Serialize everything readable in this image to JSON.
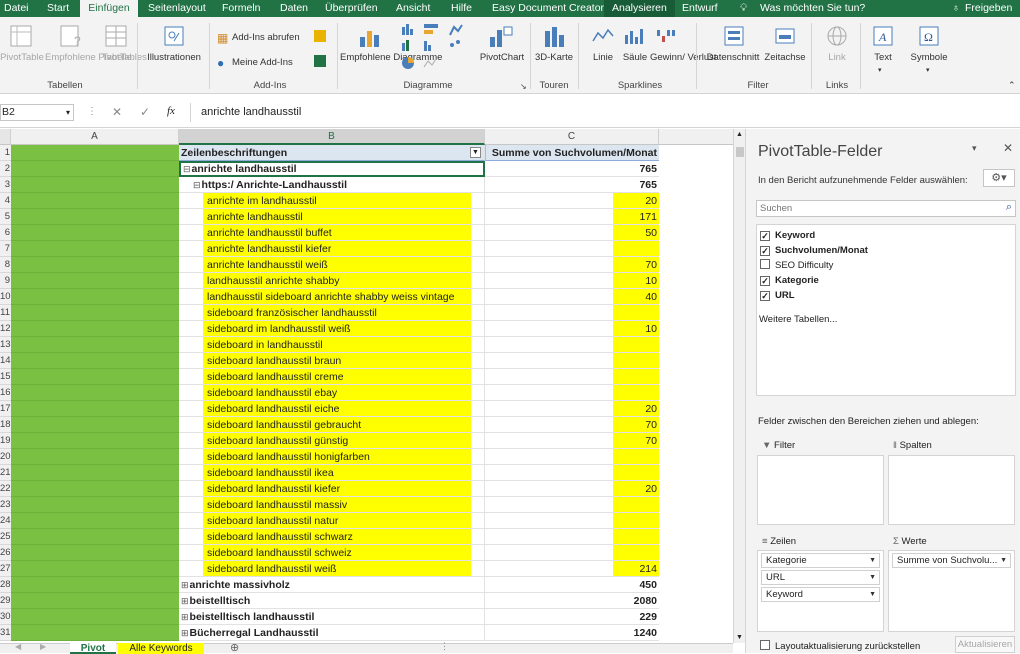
{
  "menubar": {
    "tabs": [
      "Datei",
      "Start",
      "Einfügen",
      "Seitenlayout",
      "Formeln",
      "Daten",
      "Überprüfen",
      "Ansicht",
      "Hilfe",
      "Easy Document Creator",
      "Analysieren",
      "Entwurf"
    ],
    "tell_me": "Was möchten Sie tun?",
    "share": "Freigeben"
  },
  "ribbon": {
    "pivottable": "PivotTable",
    "rec_pivot": "Empfohlene PivotTables",
    "table": "Tabelle",
    "grp_tables": "Tabellen",
    "illustrations": "Illustrationen",
    "addins_get": "Add-Ins abrufen",
    "my_addins": "Meine Add-Ins",
    "grp_addins": "Add-Ins",
    "rec_charts": "Empfohlene Diagramme",
    "grp_charts": "Diagramme",
    "pivotchart": "PivotChart",
    "map3d": "3D-Karte",
    "grp_tours": "Touren",
    "line": "Linie",
    "column": "Säule",
    "winloss": "Gewinn/ Verlust",
    "grp_sparklines": "Sparklines",
    "slicer": "Datenschnitt",
    "timeline": "Zeitachse",
    "grp_filter": "Filter",
    "link": "Link",
    "grp_links": "Links",
    "text": "Text",
    "symbols": "Symbole"
  },
  "formula": {
    "namebox": "B2",
    "fx": "fx",
    "value": "anrichte landhausstil"
  },
  "grid": {
    "col_a": "A",
    "col_b": "B",
    "col_c": "C",
    "header_b": "Zeilenbeschriftungen",
    "header_c": "Summe von Suchvolumen/Monat",
    "rows": [
      {
        "n": "2",
        "label": "anrichte landhausstil",
        "val": "765",
        "lvl": 0,
        "bold": true,
        "yellow": false
      },
      {
        "n": "3",
        "label": "https:/                  Anrichte-Landhausstil",
        "val": "765",
        "lvl": 1,
        "bold": true,
        "yellow": false
      },
      {
        "n": "4",
        "label": "anrichte im landhausstil",
        "val": "20",
        "lvl": 2,
        "yellow": true
      },
      {
        "n": "5",
        "label": "anrichte landhausstil",
        "val": "171",
        "lvl": 2,
        "yellow": true
      },
      {
        "n": "6",
        "label": "anrichte landhausstil buffet",
        "val": "50",
        "lvl": 2,
        "yellow": true
      },
      {
        "n": "7",
        "label": "anrichte landhausstil kiefer",
        "val": "",
        "lvl": 2,
        "yellow": true
      },
      {
        "n": "8",
        "label": "anrichte landhausstil weiß",
        "val": "70",
        "lvl": 2,
        "yellow": true
      },
      {
        "n": "9",
        "label": "landhausstil anrichte shabby",
        "val": "10",
        "lvl": 2,
        "yellow": true
      },
      {
        "n": "10",
        "label": "landhausstil sideboard anrichte shabby weiss vintage",
        "val": "40",
        "lvl": 2,
        "yellow": true
      },
      {
        "n": "11",
        "label": "sideboard französischer landhausstil",
        "val": "",
        "lvl": 2,
        "yellow": true
      },
      {
        "n": "12",
        "label": "sideboard im landhausstil weiß",
        "val": "10",
        "lvl": 2,
        "yellow": true
      },
      {
        "n": "13",
        "label": "sideboard in landhausstil",
        "val": "",
        "lvl": 2,
        "yellow": true
      },
      {
        "n": "14",
        "label": "sideboard landhausstil braun",
        "val": "",
        "lvl": 2,
        "yellow": true
      },
      {
        "n": "15",
        "label": "sideboard landhausstil creme",
        "val": "",
        "lvl": 2,
        "yellow": true
      },
      {
        "n": "16",
        "label": "sideboard landhausstil ebay",
        "val": "",
        "lvl": 2,
        "yellow": true
      },
      {
        "n": "17",
        "label": "sideboard landhausstil eiche",
        "val": "20",
        "lvl": 2,
        "yellow": true
      },
      {
        "n": "18",
        "label": "sideboard landhausstil gebraucht",
        "val": "70",
        "lvl": 2,
        "yellow": true
      },
      {
        "n": "19",
        "label": "sideboard landhausstil günstig",
        "val": "70",
        "lvl": 2,
        "yellow": true
      },
      {
        "n": "20",
        "label": "sideboard landhausstil honigfarben",
        "val": "",
        "lvl": 2,
        "yellow": true
      },
      {
        "n": "21",
        "label": "sideboard landhausstil ikea",
        "val": "",
        "lvl": 2,
        "yellow": true
      },
      {
        "n": "22",
        "label": "sideboard landhausstil kiefer",
        "val": "20",
        "lvl": 2,
        "yellow": true
      },
      {
        "n": "23",
        "label": "sideboard landhausstil massiv",
        "val": "",
        "lvl": 2,
        "yellow": true
      },
      {
        "n": "24",
        "label": "sideboard landhausstil natur",
        "val": "",
        "lvl": 2,
        "yellow": true
      },
      {
        "n": "25",
        "label": "sideboard landhausstil schwarz",
        "val": "",
        "lvl": 2,
        "yellow": true
      },
      {
        "n": "26",
        "label": "sideboard landhausstil schweiz",
        "val": "",
        "lvl": 2,
        "yellow": true
      },
      {
        "n": "27",
        "label": "sideboard landhausstil weiß",
        "val": "214",
        "lvl": 2,
        "yellow": true
      },
      {
        "n": "28",
        "label": "anrichte massivholz",
        "val": "450",
        "lvl": 0,
        "bold": true,
        "yellow": false,
        "collapsed": true
      },
      {
        "n": "29",
        "label": "beistelltisch",
        "val": "2080",
        "lvl": 0,
        "bold": true,
        "yellow": false,
        "collapsed": true
      },
      {
        "n": "30",
        "label": "beistelltisch landhausstil",
        "val": "229",
        "lvl": 0,
        "bold": true,
        "yellow": false,
        "collapsed": true
      },
      {
        "n": "31",
        "label": "Bücherregal Landhausstil",
        "val": "1240",
        "lvl": 0,
        "bold": true,
        "yellow": false,
        "collapsed": true
      }
    ]
  },
  "sheets": {
    "tab1": "Pivot",
    "tab2": "Alle Keywords"
  },
  "panel": {
    "title": "PivotTable-Felder",
    "subtitle": "In den Bericht aufzunehmende Felder auswählen:",
    "search_placeholder": "Suchen",
    "fields": [
      {
        "label": "Keyword",
        "checked": true
      },
      {
        "label": "Suchvolumen/Monat",
        "checked": true
      },
      {
        "label": "SEO Difficulty",
        "checked": false
      },
      {
        "label": "Kategorie",
        "checked": true
      },
      {
        "label": "URL",
        "checked": true
      }
    ],
    "more_tables": "Weitere Tabellen...",
    "drag_hint": "Felder zwischen den Bereichen ziehen und ablegen:",
    "area_filter": "Filter",
    "area_columns": "Spalten",
    "area_rows": "Zeilen",
    "area_values": "Werte",
    "row_fields": [
      "Kategorie",
      "URL",
      "Keyword"
    ],
    "value_field": "Summe von Suchvolu...",
    "defer": "Layoutaktualisierung zurückstellen",
    "update": "Aktualisieren"
  },
  "colors": {
    "accent": "#217346",
    "highlight": "#ffff00",
    "green_col": "#7ac143"
  }
}
